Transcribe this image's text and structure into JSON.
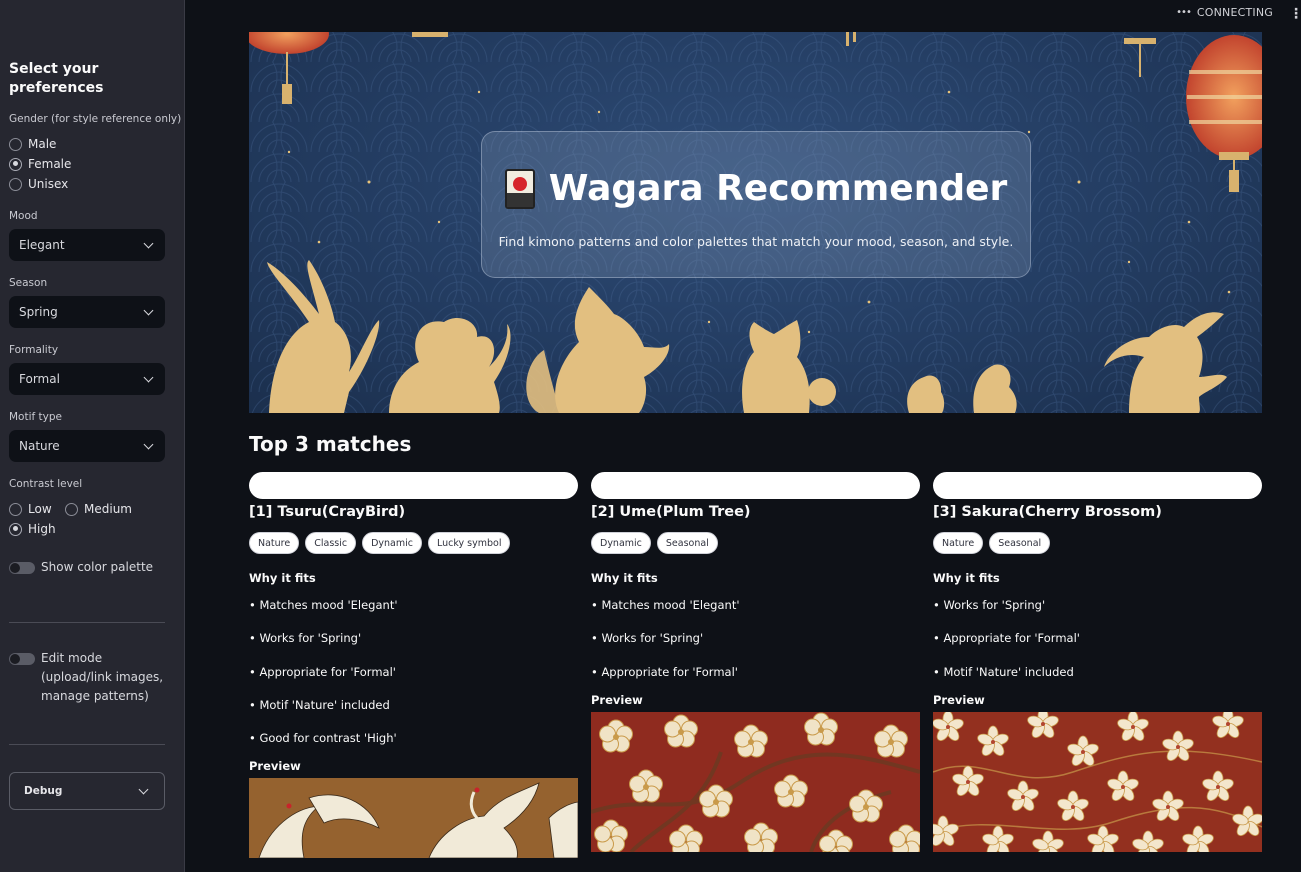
{
  "sidebar": {
    "title": "Select your preferences",
    "gender": {
      "label": "Gender (for style reference only)",
      "options": [
        "Male",
        "Female",
        "Unisex"
      ],
      "selected": "Female"
    },
    "mood": {
      "label": "Mood",
      "value": "Elegant"
    },
    "season": {
      "label": "Season",
      "value": "Spring"
    },
    "formality": {
      "label": "Formality",
      "value": "Formal"
    },
    "motif": {
      "label": "Motif type",
      "value": "Nature"
    },
    "contrast": {
      "label": "Contrast level",
      "options": [
        "Low",
        "Medium",
        "High"
      ],
      "selected": "High"
    },
    "show_palette": {
      "label": "Show color palette",
      "on": false
    },
    "edit_mode": {
      "label_line1": "Edit mode",
      "label_line2": "(upload/link images,",
      "label_line3": "manage patterns)",
      "on": false
    },
    "debug": {
      "label": "Debug"
    }
  },
  "status": {
    "text": "CONNECTING"
  },
  "hero": {
    "title": "Wagara Recommender",
    "subtitle": "Find kimono patterns and color palettes that match your mood, season, and style.",
    "icon": "hanafuda-card-icon"
  },
  "results": {
    "title": "Top 3 matches",
    "why_label": "Why it fits",
    "preview_label": "Preview",
    "items": [
      {
        "title": "[1] Tsuru(CrayBird)",
        "tags": [
          "Nature",
          "Classic",
          "Dynamic",
          "Lucky symbol"
        ],
        "reasons": [
          "• Matches mood 'Elegant'",
          "• Works for 'Spring'",
          "• Appropriate for 'Formal'",
          "• Motif 'Nature' included",
          "• Good for contrast 'High'"
        ],
        "preview": "crane-pattern"
      },
      {
        "title": "[2] Ume(Plum Tree)",
        "tags": [
          "Dynamic",
          "Seasonal"
        ],
        "reasons": [
          "• Matches mood 'Elegant'",
          "• Works for 'Spring'",
          "• Appropriate for 'Formal'"
        ],
        "preview": "plum-blossom-pattern"
      },
      {
        "title": "[3] Sakura(Cherry Brossom)",
        "tags": [
          "Nature",
          "Seasonal"
        ],
        "reasons": [
          "• Works for 'Spring'",
          "• Appropriate for 'Formal'",
          "• Motif 'Nature' included"
        ],
        "preview": "cherry-blossom-pattern"
      }
    ]
  },
  "colors": {
    "background": "#0e1117",
    "sidebar": "#262730",
    "hero_blue": "#233c61",
    "gold": "#d8b26e",
    "pattern_red": "#8f2b1f"
  }
}
